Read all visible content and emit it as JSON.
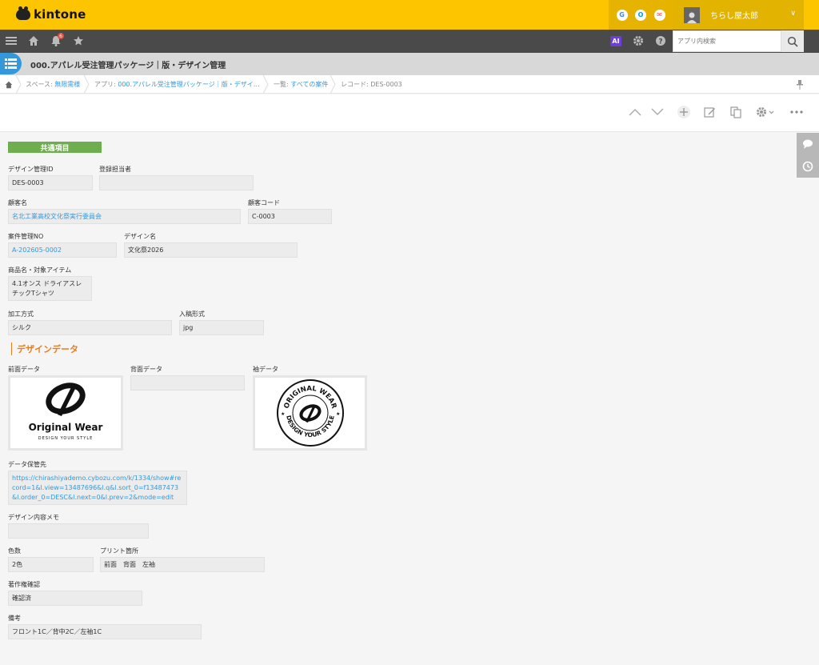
{
  "header": {
    "logo": "kintone",
    "user_name": "ちらし屋太郎"
  },
  "header_icons": [
    "G",
    "O",
    "✉"
  ],
  "nav": {
    "notification_count": "6",
    "ai_label": "AI",
    "search_placeholder": "アプリ内検索"
  },
  "app": {
    "title": "000.アパレル受注管理パッケージ｜版・デザイン管理"
  },
  "breadcrumb": {
    "space_prefix": "スペース: ",
    "space_link": "無限需様",
    "app_prefix": "アプリ: ",
    "app_link": "000.アパレル受注管理パッケージ｜版・デザイ…",
    "list_prefix": "一覧: ",
    "list_link": "すべての案件",
    "record": "レコード: DES-0003"
  },
  "group": {
    "label": "共通項目"
  },
  "fields": {
    "design_id": {
      "label": "デザイン管理ID",
      "value": "DES-0003"
    },
    "registrant": {
      "label": "登録担当者",
      "value": ""
    },
    "customer_name": {
      "label": "顧客名",
      "value": "名北工業高校文化祭実行委員会"
    },
    "customer_code": {
      "label": "顧客コード",
      "value": "C-0003"
    },
    "case_no": {
      "label": "案件管理NO",
      "value": "A-202605-0002"
    },
    "design_name": {
      "label": "デザイン名",
      "value": "文化祭2026"
    },
    "product": {
      "label": "商品名・対象アイテム",
      "value": "4.1オンス ドライアスレチックTシャツ"
    },
    "process": {
      "label": "加工方式",
      "value": "シルク"
    },
    "format": {
      "label": "入稿形式",
      "value": "jpg"
    },
    "data_location": {
      "label": "データ保管先",
      "value": "https://chirashiyademo.cybozu.com/k/1334/show#record=1&l.view=13487696&l.q&l.sort_0=f13487473&l.order_0=DESC&l.next=0&l.prev=2&mode=edit"
    },
    "design_memo": {
      "label": "デザイン内容メモ",
      "value": ""
    },
    "colors": {
      "label": "色数",
      "value": "2色"
    },
    "print_location": {
      "label": "プリント箇所",
      "value": "前面　背面　左袖"
    },
    "copyright": {
      "label": "著作権確認",
      "value": "確認済"
    },
    "notes": {
      "label": "備考",
      "value": "フロント1C／背中2C／左袖1C"
    }
  },
  "design_section": {
    "title": "デザインデータ",
    "front_label": "前面データ",
    "back_label": "背面データ",
    "sleeve_label": "袖データ",
    "logo_text": "Original Wear",
    "logo_tagline": "DESIGN YOUR STYLE",
    "seal_top": "ORIGINAL WEAR",
    "seal_bottom": "DESIGN YOUR STYLE"
  }
}
